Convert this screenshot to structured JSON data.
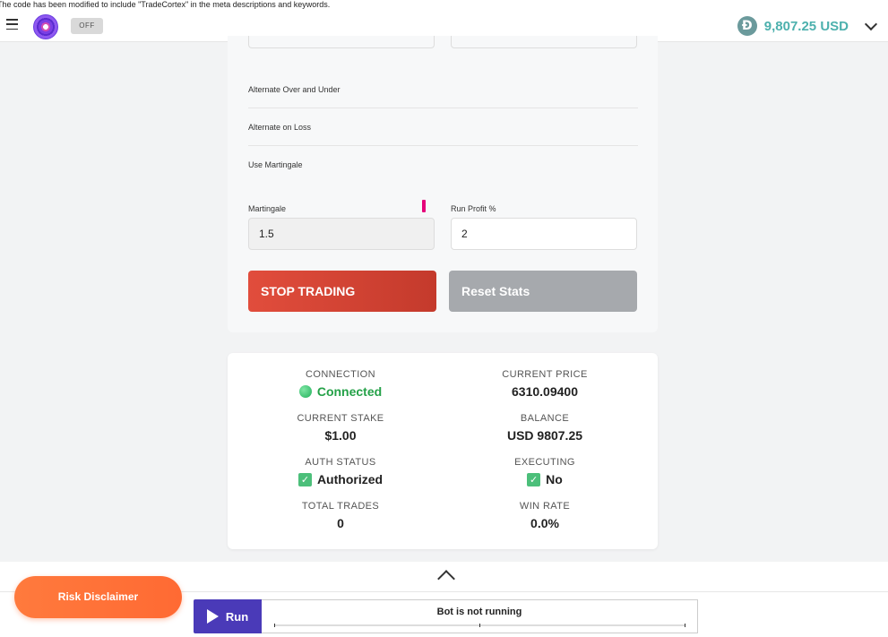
{
  "notice": "The code has been modified to include \"TradeCortex\" in the meta descriptions and keywords.",
  "topbar": {
    "toggle_label": "OFF",
    "balance": "9,807.25 USD",
    "coin_symbol": "Đ"
  },
  "settings": {
    "toggles": [
      "Alternate Over and Under",
      "Alternate on Loss",
      "Use Martingale"
    ],
    "martingale_label": "Martingale",
    "martingale_value": "1.5",
    "run_profit_label": "Run Profit %",
    "run_profit_value": "2",
    "stop_button": "STOP TRADING",
    "reset_button": "Reset Stats"
  },
  "stats": {
    "connection_label": "CONNECTION",
    "connection_value": "Connected",
    "current_price_label": "CURRENT PRICE",
    "current_price_value": "6310.09400",
    "current_stake_label": "CURRENT STAKE",
    "current_stake_value": "$1.00",
    "balance_label": "BALANCE",
    "balance_value": "USD 9807.25",
    "auth_status_label": "AUTH STATUS",
    "auth_status_value": "Authorized",
    "executing_label": "EXECUTING",
    "executing_value": "No",
    "total_trades_label": "TOTAL TRADES",
    "total_trades_value": "0",
    "win_rate_label": "WIN RATE",
    "win_rate_value": "0.0%"
  },
  "bottom": {
    "risk_button": "Risk Disclaimer",
    "run_button": "Run",
    "status": "Bot is not running"
  },
  "colors": {
    "accent": "#4a3ab8",
    "stop": "#d8443a",
    "connected": "#24a148",
    "balance": "#4cb0ad",
    "risk": "#ff7038"
  },
  "icons": [
    "menu-icon",
    "app-logo",
    "coin-icon",
    "chevron-down-icon",
    "connection-dot-icon",
    "check-icon",
    "chevron-up-icon",
    "play-icon"
  ]
}
